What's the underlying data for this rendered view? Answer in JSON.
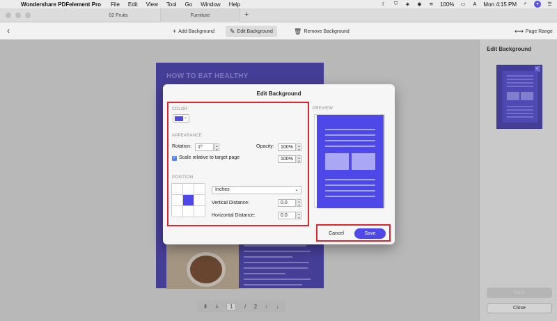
{
  "menubar": {
    "app_name": "Wondershare PDFelement Pro",
    "menus": [
      "File",
      "Edit",
      "View",
      "Tool",
      "Go",
      "Window",
      "Help"
    ],
    "battery": "100%",
    "clock": "Mon 4:15 PM"
  },
  "tabs": [
    {
      "label": "02 Fruits"
    },
    {
      "label": "Furniture"
    }
  ],
  "toolbar": {
    "add_background": "Add Background",
    "edit_background": "Edit Background",
    "remove_background": "Remove Background",
    "page_range": "Page Range"
  },
  "document": {
    "title": "HOW TO EAT HEALTHY"
  },
  "pager": {
    "current": "1",
    "separator": "/",
    "total": "2"
  },
  "side_panel": {
    "title": "Edit Background",
    "apply_label": "Apply",
    "close_label": "Close"
  },
  "dialog": {
    "title": "Edit Background",
    "color": {
      "section_label": "COLOR",
      "value": "#4f48e8"
    },
    "appearance": {
      "section_label": "APPEARANCE",
      "rotation_label": "Rotation:",
      "rotation_value": "1º",
      "opacity_label": "Opacity:",
      "opacity_value": "100%",
      "scale_label": "Scale relative to target page",
      "scale_checked": true,
      "scale_value": "100%"
    },
    "position": {
      "section_label": "POSITION",
      "selected_cell": 4,
      "units": "Inches",
      "vertical_label": "Vertical Distance:",
      "vertical_value": "0.0",
      "horizontal_label": "Horizontal Distance:",
      "horizontal_value": "0.0"
    },
    "preview_label": "PREVIEW",
    "cancel_label": "Cancel",
    "save_label": "Save"
  },
  "colors": {
    "accent": "#4f48e8",
    "highlight": "#e0242f",
    "page_bg": "#3f37a8"
  }
}
